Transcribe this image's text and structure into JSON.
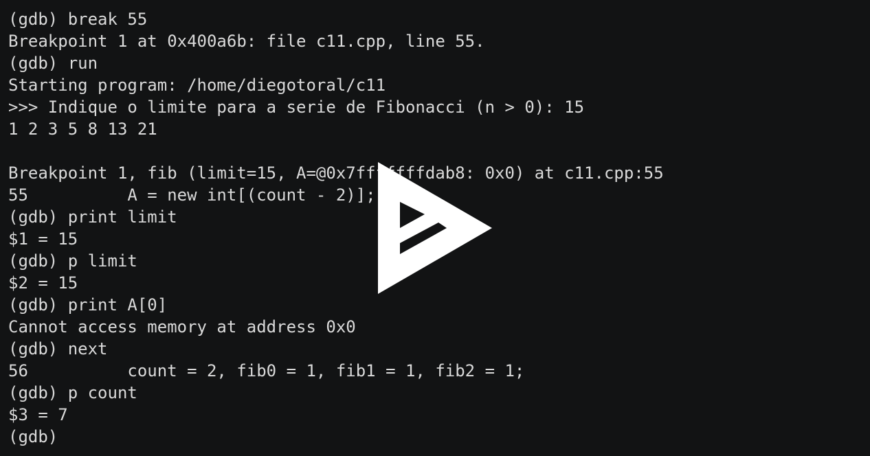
{
  "terminal": {
    "lines": [
      "(gdb) break 55",
      "Breakpoint 1 at 0x400a6b: file c11.cpp, line 55.",
      "(gdb) run",
      "Starting program: /home/diegotoral/c11",
      ">>> Indique o limite para a serie de Fibonacci (n > 0): 15",
      "1 2 3 5 8 13 21",
      "",
      "Breakpoint 1, fib (limit=15, A=@0x7fffffffdab8: 0x0) at c11.cpp:55",
      "55          A = new int[(count - 2)];",
      "(gdb) print limit",
      "$1 = 15",
      "(gdb) p limit",
      "$2 = 15",
      "(gdb) print A[0]",
      "Cannot access memory at address 0x0",
      "(gdb) next",
      "56          count = 2, fib0 = 1, fib1 = 1, fib2 = 1;",
      "(gdb) p count",
      "$3 = 7",
      "(gdb)"
    ]
  },
  "overlay": {
    "icon": "asciinema-play-icon",
    "color": "#ffffff"
  },
  "colors": {
    "background": "#121314",
    "text": "#dadada"
  }
}
